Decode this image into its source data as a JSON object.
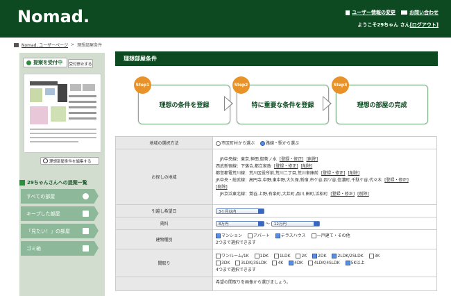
{
  "header": {
    "logo": "Nomad.",
    "user_info_change": "ユーザー情報の変更",
    "contact": "お問い合わせ",
    "welcome_prefix": "ようこそ29ちゃん さん",
    "logout": "[ログアウト]"
  },
  "breadcrumb": {
    "home": "Nomad. ユーザーページ",
    "separator": ">",
    "current": "理想部屋条件"
  },
  "sidebar": {
    "accept_button": "提案を受付中",
    "stop_button": "受付停止する",
    "edit_conditions": "理想部屋条件を編集する",
    "proposals_title": "29ちゃんさんへの提案一覧",
    "menu": [
      {
        "label": "すべての部屋"
      },
      {
        "label": "キープした部屋"
      },
      {
        "label": "「見たい！」の部屋"
      },
      {
        "label": "ゴミ箱"
      }
    ]
  },
  "main": {
    "title": "理想部屋条件",
    "steps": [
      {
        "badge": "Step1",
        "label": "理想の条件を登録"
      },
      {
        "badge": "Step2",
        "label": "特に重要な条件を登録"
      },
      {
        "badge": "Step3",
        "label": "理想の部屋の完成"
      }
    ]
  },
  "form": {
    "area_method": {
      "label": "地域の選択方法",
      "option1": "市区町村から選ぶ",
      "option2": "路線・駅から選ぶ"
    },
    "search_area": {
      "label": "お探しの地域",
      "lines": [
        {
          "text": "JR中央線：東京,神田,御茶ノ水",
          "actions": [
            "[登録・修正]",
            "[削除]"
          ]
        },
        {
          "text": "西武新宿線：下落合,都立家政",
          "actions": [
            "[登録・修正]",
            "[削除]"
          ]
        },
        {
          "text": "都営都電荒川線：荒川区役所前,荒川二丁目,荒川車庫前",
          "actions": [
            "[登録・修正]",
            "[削除]"
          ]
        },
        {
          "text": "JR中央・総武線：高円寺,中野,東中野,大久保,新宿,市ケ谷,四ツ谷,信濃町,千駄ケ谷,代々木",
          "actions": [
            "[登録・修正]",
            "[削除]"
          ]
        },
        {
          "text": "JR京浜東北線：鶯谷,上野,有楽町,大井町,品川,田町,浜松町",
          "actions": [
            "[登録・修正]",
            "[削除]"
          ]
        }
      ]
    },
    "move_date": {
      "label": "引越し希望日",
      "value": "3ヶ月以内"
    },
    "rent": {
      "label": "賃料",
      "min": "8万円",
      "tilde": "〜",
      "max": "12万円"
    },
    "building_type": {
      "label": "建物種別",
      "options": [
        {
          "label": "マンション",
          "checked": true
        },
        {
          "label": "アパート",
          "checked": false
        },
        {
          "label": "テラスハウス",
          "checked": true
        },
        {
          "label": "一戸建て・その他",
          "checked": false
        }
      ],
      "note": "2つまで選択できます"
    },
    "layout": {
      "label": "間取り",
      "row1": [
        {
          "label": "ワンルーム/1K",
          "checked": false
        },
        {
          "label": "1DK",
          "checked": false
        },
        {
          "label": "1LDK",
          "checked": false
        },
        {
          "label": "2K",
          "checked": false
        },
        {
          "label": "2DK",
          "checked": true
        },
        {
          "label": "2LDK/2SLDK",
          "checked": true
        },
        {
          "label": "3K",
          "checked": false
        }
      ],
      "row2": [
        {
          "label": "3DK",
          "checked": false
        },
        {
          "label": "3LDK/3SLDK",
          "checked": false
        },
        {
          "label": "4K",
          "checked": false
        },
        {
          "label": "4DK",
          "checked": true
        },
        {
          "label": "4LDK/4SLDK",
          "checked": false
        },
        {
          "label": "5K以上",
          "checked": true
        }
      ],
      "note": "4つまで選択できます"
    },
    "preferred_layout_text": "希望の間取りを画像から選びましょう。"
  }
}
